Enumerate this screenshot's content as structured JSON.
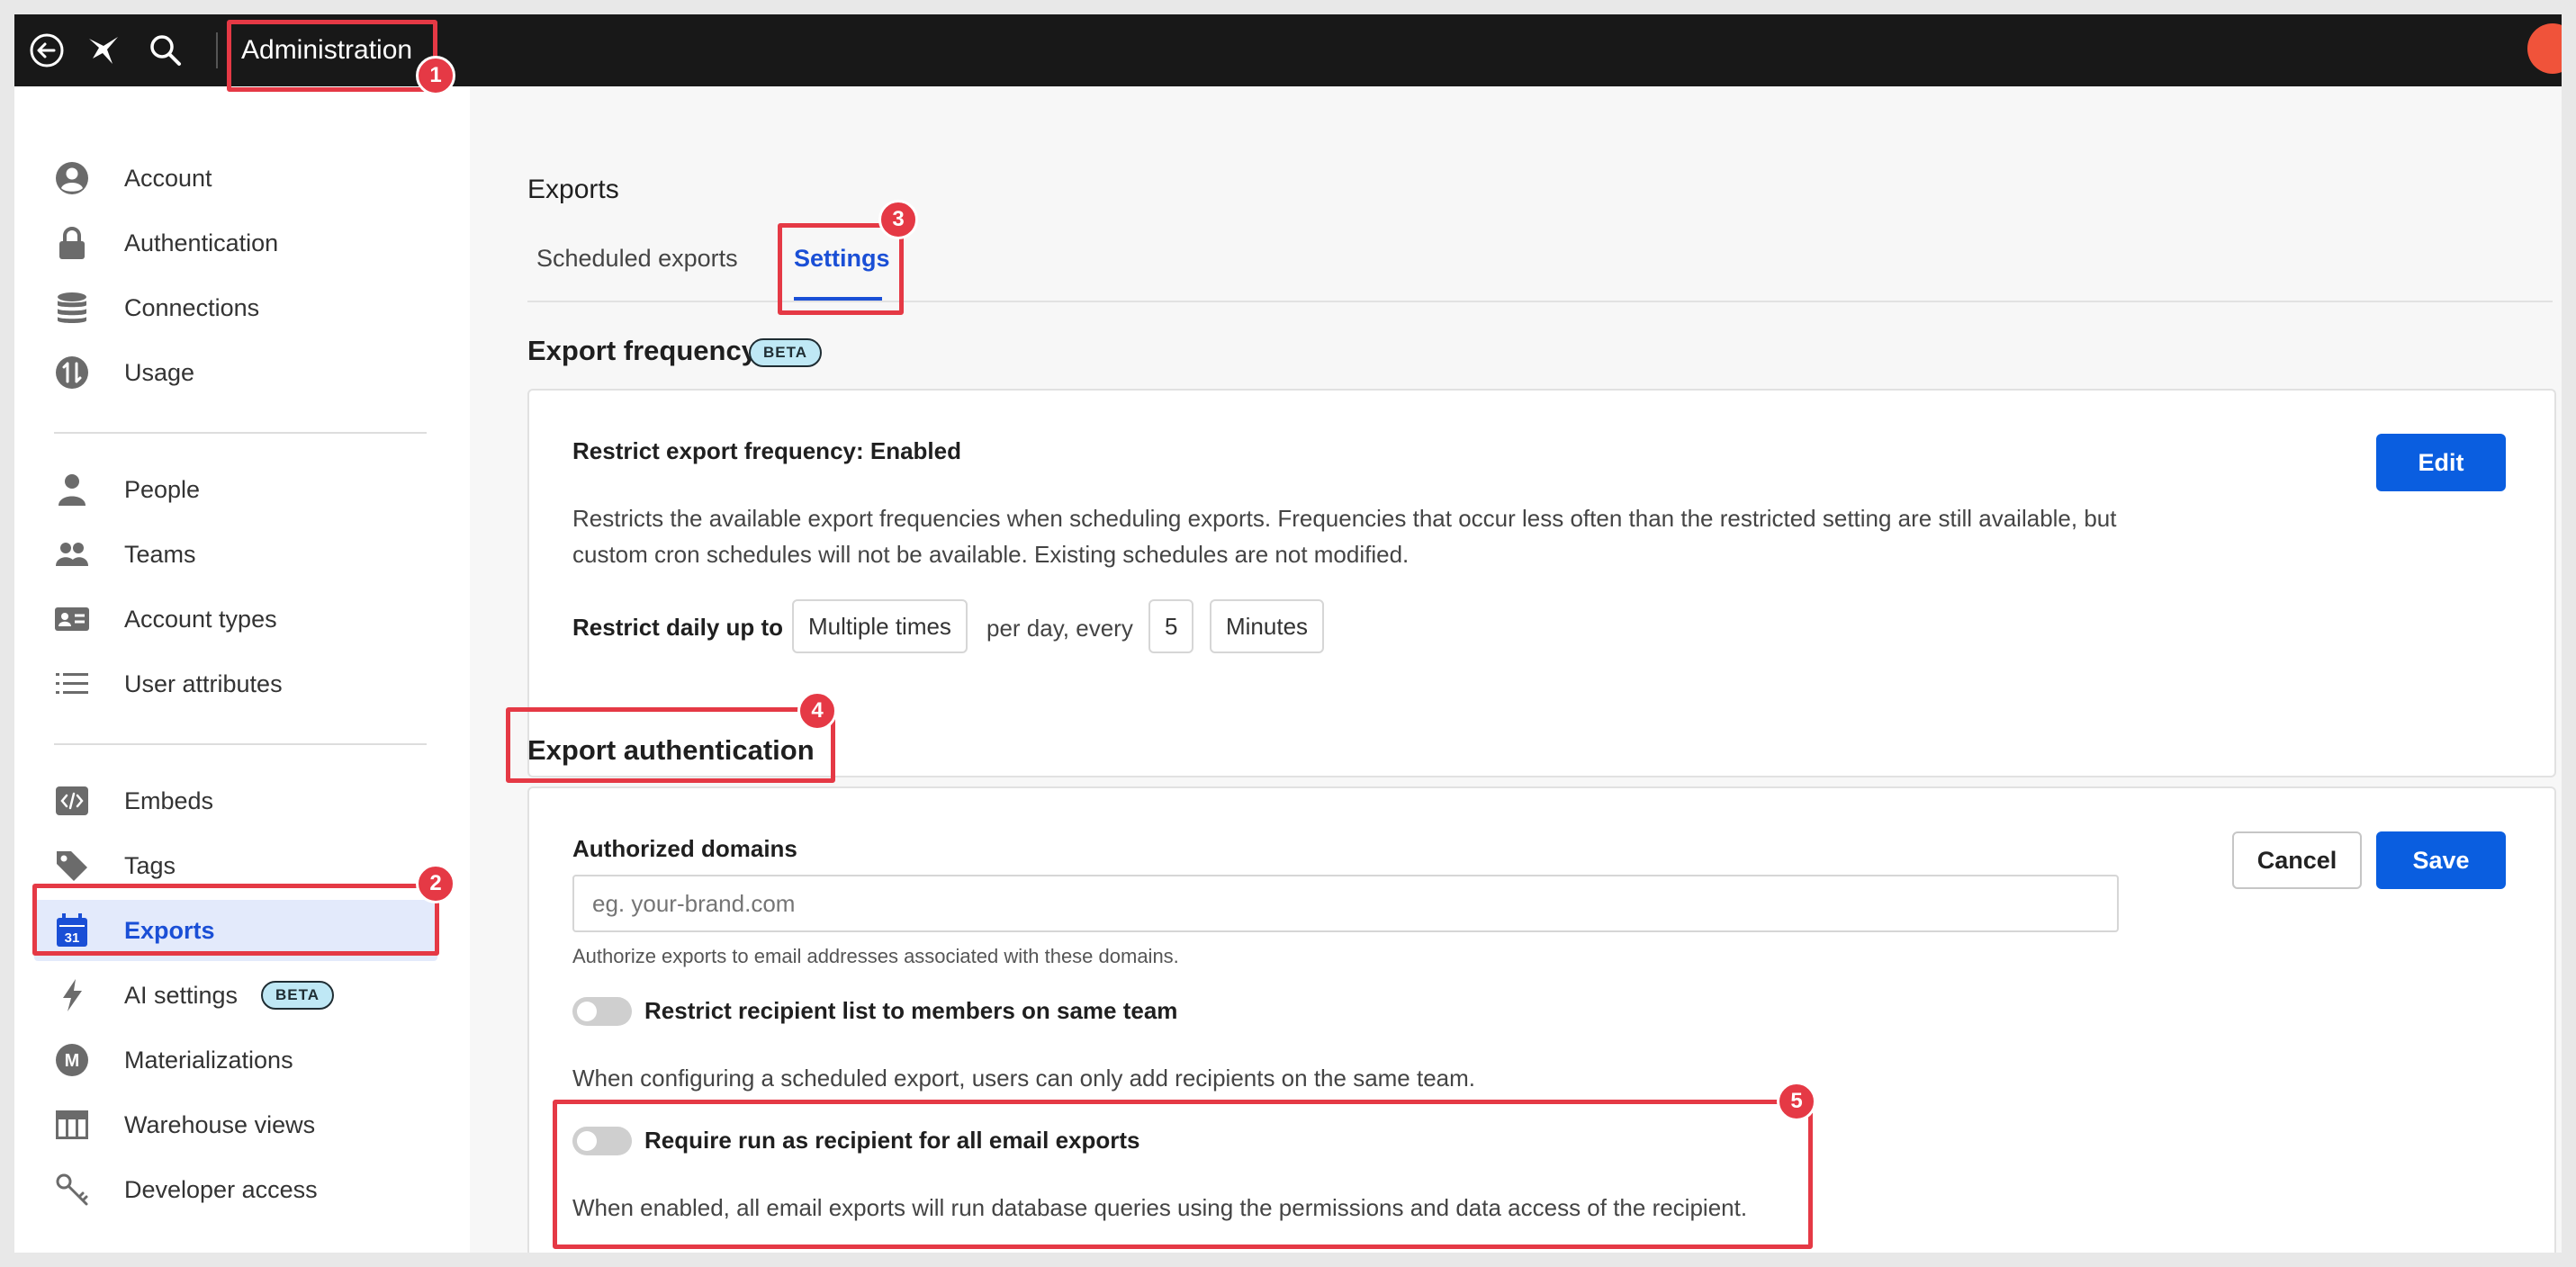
{
  "topbar": {
    "title": "Administration",
    "icons": [
      "back-arrow-icon",
      "logo-icon",
      "search-icon"
    ]
  },
  "sidebar": {
    "groups": [
      {
        "items": [
          {
            "label": "Account",
            "icon": "account-icon"
          },
          {
            "label": "Authentication",
            "icon": "lock-icon"
          },
          {
            "label": "Connections",
            "icon": "database-icon"
          },
          {
            "label": "Usage",
            "icon": "usage-icon"
          }
        ]
      },
      {
        "items": [
          {
            "label": "People",
            "icon": "person-icon"
          },
          {
            "label": "Teams",
            "icon": "teams-icon"
          },
          {
            "label": "Account types",
            "icon": "id-card-icon"
          },
          {
            "label": "User attributes",
            "icon": "list-icon"
          }
        ]
      },
      {
        "items": [
          {
            "label": "Embeds",
            "icon": "code-icon"
          },
          {
            "label": "Tags",
            "icon": "tag-icon"
          },
          {
            "label": "Exports",
            "icon": "calendar-icon",
            "active": true,
            "calendar_day": "31"
          },
          {
            "label": "AI settings",
            "icon": "lightning-icon",
            "badge": "BETA"
          },
          {
            "label": "Materializations",
            "icon": "materialization-icon",
            "icon_letter": "M"
          },
          {
            "label": "Warehouse views",
            "icon": "table-icon"
          },
          {
            "label": "Developer access",
            "icon": "key-icon"
          }
        ]
      }
    ]
  },
  "main": {
    "title": "Exports",
    "tabs": [
      {
        "label": "Scheduled exports",
        "active": false
      },
      {
        "label": "Settings",
        "active": true
      }
    ],
    "export_frequency": {
      "heading": "Export frequency",
      "badge": "BETA",
      "label": "Restrict export frequency: Enabled",
      "description": "Restricts the available export frequencies when scheduling exports. Frequencies that occur less often than the restricted setting are still available, but custom cron schedules will not be available. Existing schedules are not modified.",
      "edit_button": "Edit",
      "restrict_label": "Restrict daily up to",
      "times_value": "Multiple times",
      "per_day_text": "per day, every",
      "interval_value": "5",
      "unit_value": "Minutes"
    },
    "export_authentication": {
      "heading": "Export authentication",
      "domains_label": "Authorized domains",
      "domains_placeholder": "eg. your-brand.com",
      "domains_help": "Authorize exports to email addresses associated with these domains.",
      "cancel_button": "Cancel",
      "save_button": "Save",
      "toggle1_label": "Restrict recipient list to members on same team",
      "toggle1_enabled": false,
      "toggle1_description": "When configuring a scheduled export, users can only add recipients on the same team.",
      "toggle2_label": "Require run as recipient for all email exports",
      "toggle2_enabled": false,
      "toggle2_description": "When enabled, all email exports will run database queries using the permissions and data access of the recipient."
    }
  },
  "annotations": [
    "1",
    "2",
    "3",
    "4",
    "5"
  ],
  "colors": {
    "accent": "#1a4fd6",
    "primary_button": "#0a5ee0",
    "highlight": "#e53945",
    "beta_badge": "#bfe8f5"
  }
}
